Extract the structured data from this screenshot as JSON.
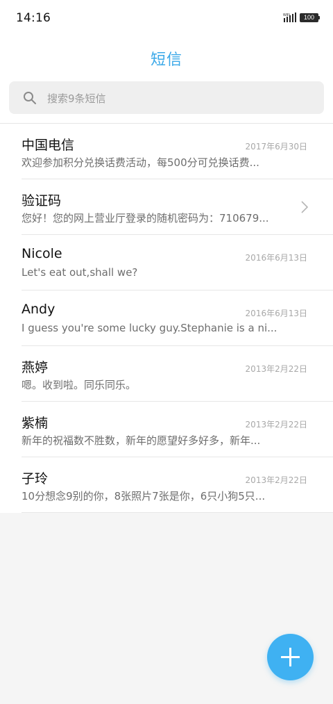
{
  "status_bar": {
    "time": "14:16",
    "battery": "100",
    "signal_icon": "wifi-signal-icon"
  },
  "header": {
    "title": "短信"
  },
  "search": {
    "placeholder": "搜索9条短信",
    "icon": "search-icon"
  },
  "messages": [
    {
      "sender": "中国电信",
      "date": "2017年6月30日",
      "preview": "欢迎参加积分兑换话费活动，每500分可兑换话费...",
      "has_chevron": false
    },
    {
      "sender": "验证码",
      "date": "",
      "preview": "您好！您的网上营业厅登录的随机密码为：710679...",
      "has_chevron": true
    },
    {
      "sender": "Nicole",
      "date": "2016年6月13日",
      "preview": "Let's eat out,shall we?",
      "has_chevron": false
    },
    {
      "sender": "Andy",
      "date": "2016年6月13日",
      "preview": "I guess you're some lucky guy.Stephanie is a ni...",
      "has_chevron": false
    },
    {
      "sender": "燕婷",
      "date": "2013年2月22日",
      "preview": "嗯。收到啦。同乐同乐。",
      "has_chevron": false
    },
    {
      "sender": "紫楠",
      "date": "2013年2月22日",
      "preview": "新年的祝福数不胜数，新年的愿望好多好多，新年...",
      "has_chevron": false
    },
    {
      "sender": "子玲",
      "date": "2013年2月22日",
      "preview": "10分想念9别的你，8张照片7张是你，6只小狗5只...",
      "has_chevron": false
    }
  ],
  "compose": {
    "icon": "plus-icon"
  },
  "colors": {
    "accent": "#3aa8e8",
    "fab": "#3fb1f2"
  }
}
